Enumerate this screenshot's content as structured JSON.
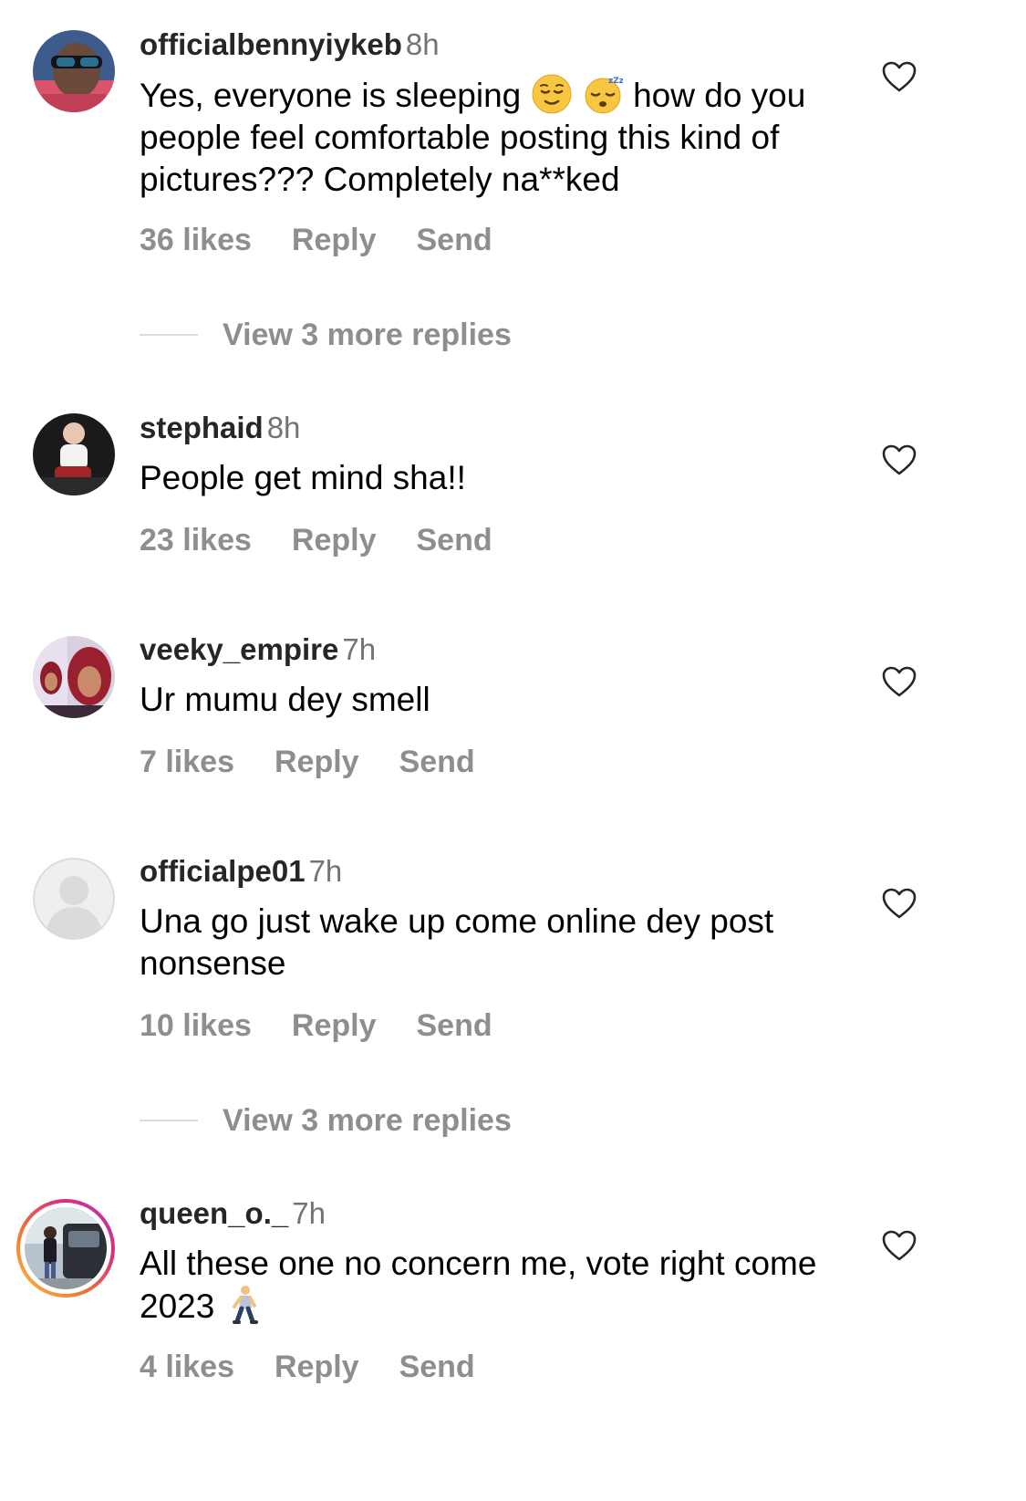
{
  "comments": [
    {
      "username": "officialbennyiykeb",
      "time": "8h",
      "text_before": "Yes, everyone is sleeping",
      "emojis": [
        "relieved-face-emoji",
        "sleeping-face-emoji"
      ],
      "text_after": "how do you people feel comfortable posting this kind of pictures??? Completely na**ked",
      "likes": "36 likes",
      "reply": "Reply",
      "send": "Send"
    },
    {
      "username": "stephaid",
      "time": "8h",
      "text": "People get mind sha!!",
      "likes": "23 likes",
      "reply": "Reply",
      "send": "Send"
    },
    {
      "username": "veeky_empire",
      "time": "7h",
      "text": "Ur mumu dey smell",
      "likes": "7 likes",
      "reply": "Reply",
      "send": "Send"
    },
    {
      "username": "officialpe01",
      "time": "7h",
      "text": "Una go just wake up come online dey post nonsense",
      "likes": "10 likes",
      "reply": "Reply",
      "send": "Send"
    },
    {
      "username": "queen_o._",
      "time": "7h",
      "text": "All these one no concern me, vote right come 2023",
      "emoji": "person-walking-emoji",
      "likes": "4 likes",
      "reply": "Reply",
      "send": "Send"
    }
  ],
  "view_more": [
    {
      "label": "View 3 more replies"
    },
    {
      "label": "View 3 more replies"
    }
  ],
  "icons": {
    "like": "heart-outline-icon",
    "default_avatar": "default-avatar-icon"
  },
  "colors": {
    "username": "#262626",
    "secondary": "#8e8e8e",
    "timestamp": "#737373",
    "divider": "#dbdbdb",
    "story_ring": [
      "#f9c33a",
      "#d9317a",
      "#b532c4"
    ]
  }
}
